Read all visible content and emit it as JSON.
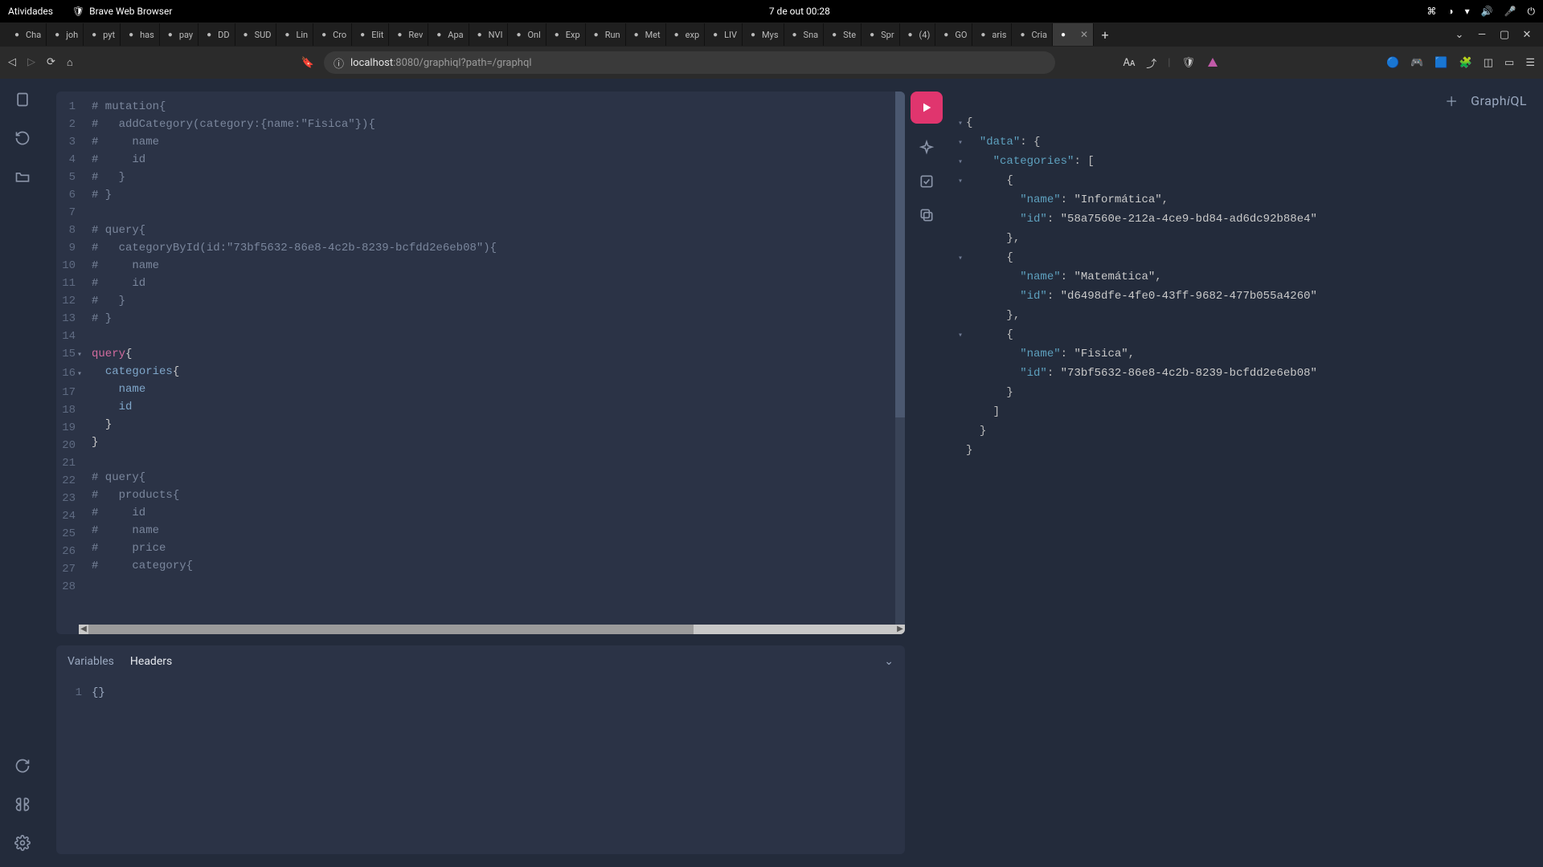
{
  "topbar": {
    "activities": "Atividades",
    "app_name": "Brave Web Browser",
    "clock": "7 de out  00:28"
  },
  "tabs": [
    {
      "label": "Cha"
    },
    {
      "label": "joh"
    },
    {
      "label": "pyt"
    },
    {
      "label": "has"
    },
    {
      "label": "pay"
    },
    {
      "label": "DD"
    },
    {
      "label": "SUD"
    },
    {
      "label": "Lin"
    },
    {
      "label": "Cro"
    },
    {
      "label": "Elit"
    },
    {
      "label": "Rev"
    },
    {
      "label": "Apa"
    },
    {
      "label": "NVI"
    },
    {
      "label": "Onl"
    },
    {
      "label": "Exp"
    },
    {
      "label": "Run"
    },
    {
      "label": "Met"
    },
    {
      "label": "exp"
    },
    {
      "label": "LIV"
    },
    {
      "label": "Mys"
    },
    {
      "label": "Sna"
    },
    {
      "label": "Ste"
    },
    {
      "label": "Spr"
    },
    {
      "label": "(4)"
    },
    {
      "label": "GO"
    },
    {
      "label": "aris"
    },
    {
      "label": "Cria"
    },
    {
      "label": "",
      "active": true
    }
  ],
  "address": {
    "host": "localhost",
    "path": ":8080/graphiql?path=/graphql"
  },
  "editor_lines": [
    {
      "n": 1,
      "type": "comment",
      "text": "# mutation{"
    },
    {
      "n": 2,
      "type": "comment",
      "text": "#   addCategory(category:{name:\"Fisica\"}){"
    },
    {
      "n": 3,
      "type": "comment",
      "text": "#     name"
    },
    {
      "n": 4,
      "type": "comment",
      "text": "#     id"
    },
    {
      "n": 5,
      "type": "comment",
      "text": "#   }"
    },
    {
      "n": 6,
      "type": "comment",
      "text": "# }"
    },
    {
      "n": 7,
      "type": "blank",
      "text": ""
    },
    {
      "n": 8,
      "type": "comment",
      "text": "# query{"
    },
    {
      "n": 9,
      "type": "comment",
      "text": "#   categoryById(id:\"73bf5632-86e8-4c2b-8239-bcfdd2e6eb08\"){"
    },
    {
      "n": 10,
      "type": "comment",
      "text": "#     name"
    },
    {
      "n": 11,
      "type": "comment",
      "text": "#     id"
    },
    {
      "n": 12,
      "type": "comment",
      "text": "#   }"
    },
    {
      "n": 13,
      "type": "comment",
      "text": "# }"
    },
    {
      "n": 14,
      "type": "blank",
      "text": ""
    },
    {
      "n": 15,
      "type": "code",
      "fold": true,
      "segments": [
        {
          "t": "query",
          "c": "kw"
        },
        {
          "t": "{",
          "c": "pun"
        }
      ]
    },
    {
      "n": 16,
      "type": "code",
      "fold": true,
      "segments": [
        {
          "t": "  ",
          "c": ""
        },
        {
          "t": "categories",
          "c": "fld"
        },
        {
          "t": "{",
          "c": "pun"
        }
      ]
    },
    {
      "n": 17,
      "type": "code",
      "segments": [
        {
          "t": "    ",
          "c": ""
        },
        {
          "t": "name",
          "c": "fld"
        }
      ]
    },
    {
      "n": 18,
      "type": "code",
      "segments": [
        {
          "t": "    ",
          "c": ""
        },
        {
          "t": "id",
          "c": "fld"
        }
      ]
    },
    {
      "n": 19,
      "type": "code",
      "segments": [
        {
          "t": "  ",
          "c": ""
        },
        {
          "t": "}",
          "c": "pun"
        }
      ]
    },
    {
      "n": 20,
      "type": "code",
      "segments": [
        {
          "t": "}",
          "c": "pun"
        }
      ]
    },
    {
      "n": 21,
      "type": "blank",
      "text": ""
    },
    {
      "n": 22,
      "type": "comment",
      "text": "# query{"
    },
    {
      "n": 23,
      "type": "comment",
      "text": "#   products{"
    },
    {
      "n": 24,
      "type": "comment",
      "text": "#     id"
    },
    {
      "n": 25,
      "type": "comment",
      "text": "#     name"
    },
    {
      "n": 26,
      "type": "comment",
      "text": "#     price"
    },
    {
      "n": 27,
      "type": "comment",
      "text": "#     category{"
    },
    {
      "n": 28,
      "type": "blank",
      "text": ""
    }
  ],
  "vars_tabs": {
    "variables": "Variables",
    "headers": "Headers"
  },
  "vars_content": "{}",
  "result": {
    "data_key": "data",
    "categories_key": "categories",
    "name_key": "name",
    "id_key": "id",
    "items": [
      {
        "name": "Informática",
        "id": "58a7560e-212a-4ce9-bd84-ad6dc92b88e4"
      },
      {
        "name": "Matemática",
        "id": "d6498dfe-4fe0-43ff-9682-477b055a4260"
      },
      {
        "name": "Fisica",
        "id": "73bf5632-86e8-4c2b-8239-bcfdd2e6eb08"
      }
    ]
  },
  "graphiql_logo": {
    "pre": "Graph",
    "em": "i",
    "post": "QL"
  }
}
